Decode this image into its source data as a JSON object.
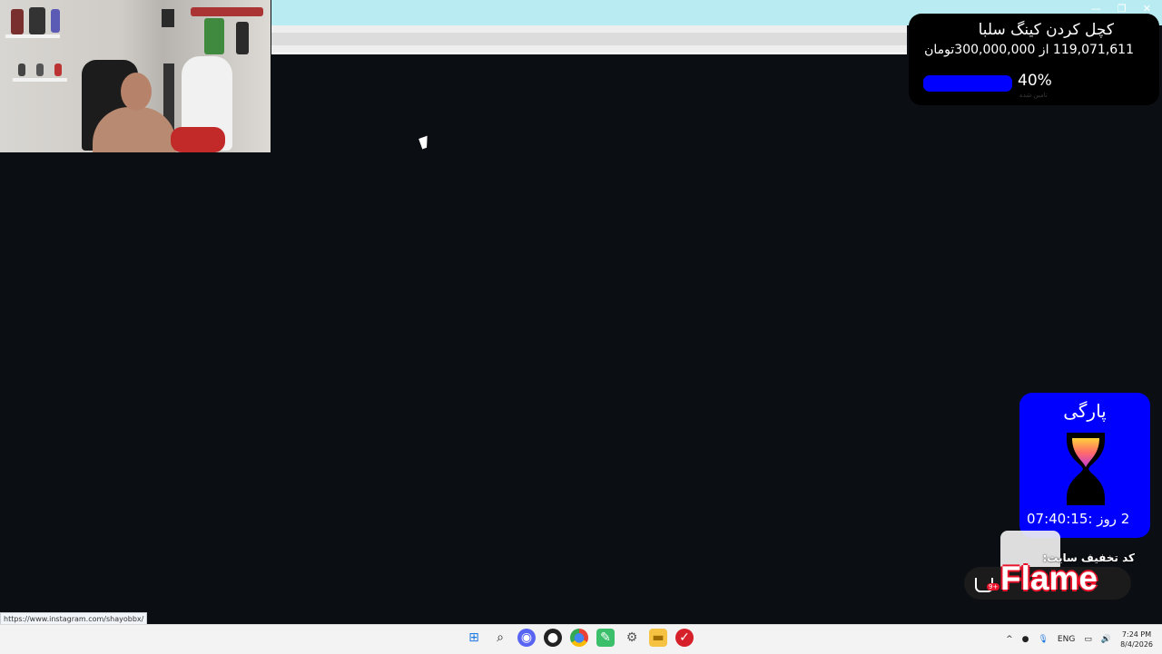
{
  "browser": {
    "window_controls": [
      "—",
      "❐",
      "✕"
    ]
  },
  "goal_widget": {
    "title": "کچل کردن کینگ سلبا",
    "amount_text": "119,071,611 از 300,000,000تومان",
    "progress_fraction": 0.4,
    "percent_label": "40%",
    "subcaption": "تامین شده",
    "bar_color": "#0000ff"
  },
  "timer_widget": {
    "label": "پارگی",
    "countdown": "2 روز :07:40:15",
    "background_color": "#0000ff"
  },
  "promo": {
    "code_label": "کد تخفیف سایت:",
    "brand": "Flame",
    "cart_count": "9+"
  },
  "status_bar": {
    "url": "https://www.instagram.com/shayobbx/"
  },
  "taskbar": {
    "pinned": [
      "windows-start-icon",
      "search-icon",
      "discord-icon",
      "obs-icon",
      "chrome-icon",
      "app-icon",
      "settings-icon",
      "file-explorer-icon",
      "red-app-icon"
    ],
    "tray": {
      "language": "ENG",
      "time": "7:24 PM",
      "date": "8/4/2026"
    }
  }
}
